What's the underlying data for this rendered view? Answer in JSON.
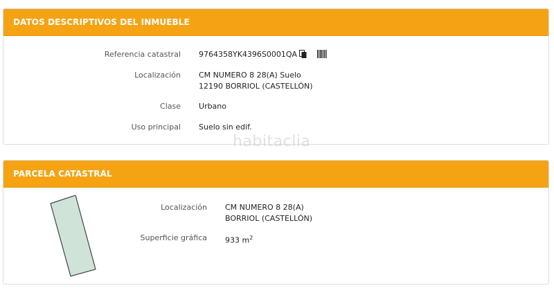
{
  "sections": [
    {
      "title": "DATOS DESCRIPTIVOS DEL INMUEBLE",
      "fields": [
        {
          "label": "Referencia catastral",
          "value": "9764358YK4396S0001QA"
        },
        {
          "label": "Localización",
          "lines": [
            "CM NUMERO 8 28(A) Suelo",
            "12190 BORRIOL (CASTELLÓN)"
          ]
        },
        {
          "label": "Clase",
          "value": "Urbano"
        },
        {
          "label": "Uso principal",
          "value": "Suelo sin edif."
        }
      ],
      "icons": [
        "copy-icon",
        "barcode-icon"
      ]
    },
    {
      "title": "PARCELA CATASTRAL",
      "fields": [
        {
          "label": "Localización",
          "lines": [
            "CM NUMERO 8 28(A)",
            "BORRIOL (CASTELLÓN)"
          ]
        },
        {
          "label": "Superficie gráfica",
          "value": "933 m",
          "unit_sup": "2"
        }
      ],
      "parcel_fill": "#cfe3d8",
      "parcel_stroke": "#444444"
    }
  ],
  "watermark": "habitaclia",
  "colors": {
    "header": "#f6a313",
    "header_text": "#ffffff"
  }
}
